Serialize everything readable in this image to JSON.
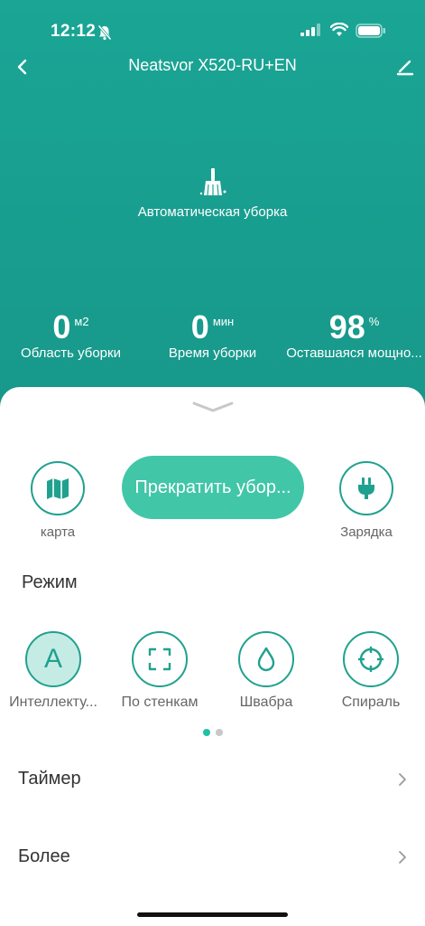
{
  "status_bar": {
    "time": "12:12"
  },
  "header": {
    "title": "Neatsvor X520-RU+EN"
  },
  "current_mode": {
    "label": "Автоматическая уборка",
    "icon": "broom-icon"
  },
  "stats": [
    {
      "value": "0",
      "unit": "м2",
      "label": "Область уборки"
    },
    {
      "value": "0",
      "unit": "мин",
      "label": "Время уборки"
    },
    {
      "value": "98",
      "unit": "%",
      "label": "Оставшаяся мощно..."
    }
  ],
  "actions": {
    "map_label": "карта",
    "stop_label": "Прекратить убор...",
    "charge_label": "Зарядка"
  },
  "mode_section": {
    "title": "Режим",
    "modes": [
      {
        "label": "Интеллекту...",
        "icon": "letter-a-icon",
        "glyph": "A",
        "active": true
      },
      {
        "label": "По стенкам",
        "icon": "frame-corners-icon",
        "active": false
      },
      {
        "label": "Швабра",
        "icon": "water-drop-icon",
        "active": false
      },
      {
        "label": "Спираль",
        "icon": "spiral-target-icon",
        "active": false
      }
    ],
    "page_indicator": {
      "current": 1,
      "total": 2
    }
  },
  "menu": {
    "timer_label": "Таймер",
    "more_label": "Более"
  },
  "colors": {
    "primary": "#1b9f8f",
    "accent_button": "#41c6a8",
    "icon_stroke": "#20a18f",
    "active_mode_bg": "#c5ece4"
  }
}
